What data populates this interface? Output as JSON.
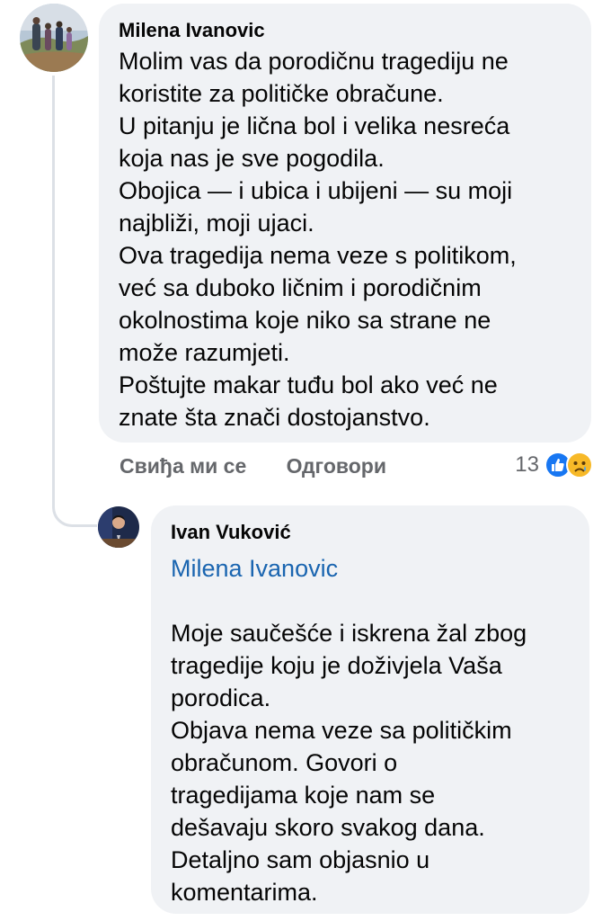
{
  "comment": {
    "author": "Milena Ivanovic",
    "lines": [
      "Molim vas da porodičnu tragediju ne",
      "koristite za političke obračune.",
      "U pitanju je lična bol i velika nesreća",
      "koja nas je sve pogodila.",
      "Obojica — i ubica i ubijeni — su moji",
      "najbliži, moji ujaci.",
      "Ova tragedija nema veze s politikom,",
      "već sa duboko ličnim i porodičnim",
      "okolnostima koje niko sa strane ne",
      "može razumjeti.",
      "Poštujte makar tuđu bol ako već ne",
      "znate šta znači dostojanstvo."
    ],
    "actions": {
      "like": "Свиђа ми се",
      "reply": "Одговори"
    },
    "reactions": {
      "count": "13",
      "icons": [
        "like-icon",
        "sad-icon"
      ]
    }
  },
  "reply": {
    "author": "Ivan Vuković",
    "mention": "Milena Ivanovic",
    "lines_p1": [
      "Moje saučešće i iskrena žal zbog",
      "tragedije koju je doživjela Vaša",
      "porodica.",
      "Objava nema veze sa političkim",
      "obračunom. Govori o",
      "tragedijama koje nam se",
      "dešavaju skoro svakog dana.",
      "Detaljno sam objasnio u",
      "komentarima."
    ]
  },
  "colors": {
    "bubble": "#f0f2f5",
    "text": "#050505",
    "muted": "#65676b",
    "mention": "#1a65b0",
    "like": "#1877f2",
    "sad": "#f7b928"
  }
}
